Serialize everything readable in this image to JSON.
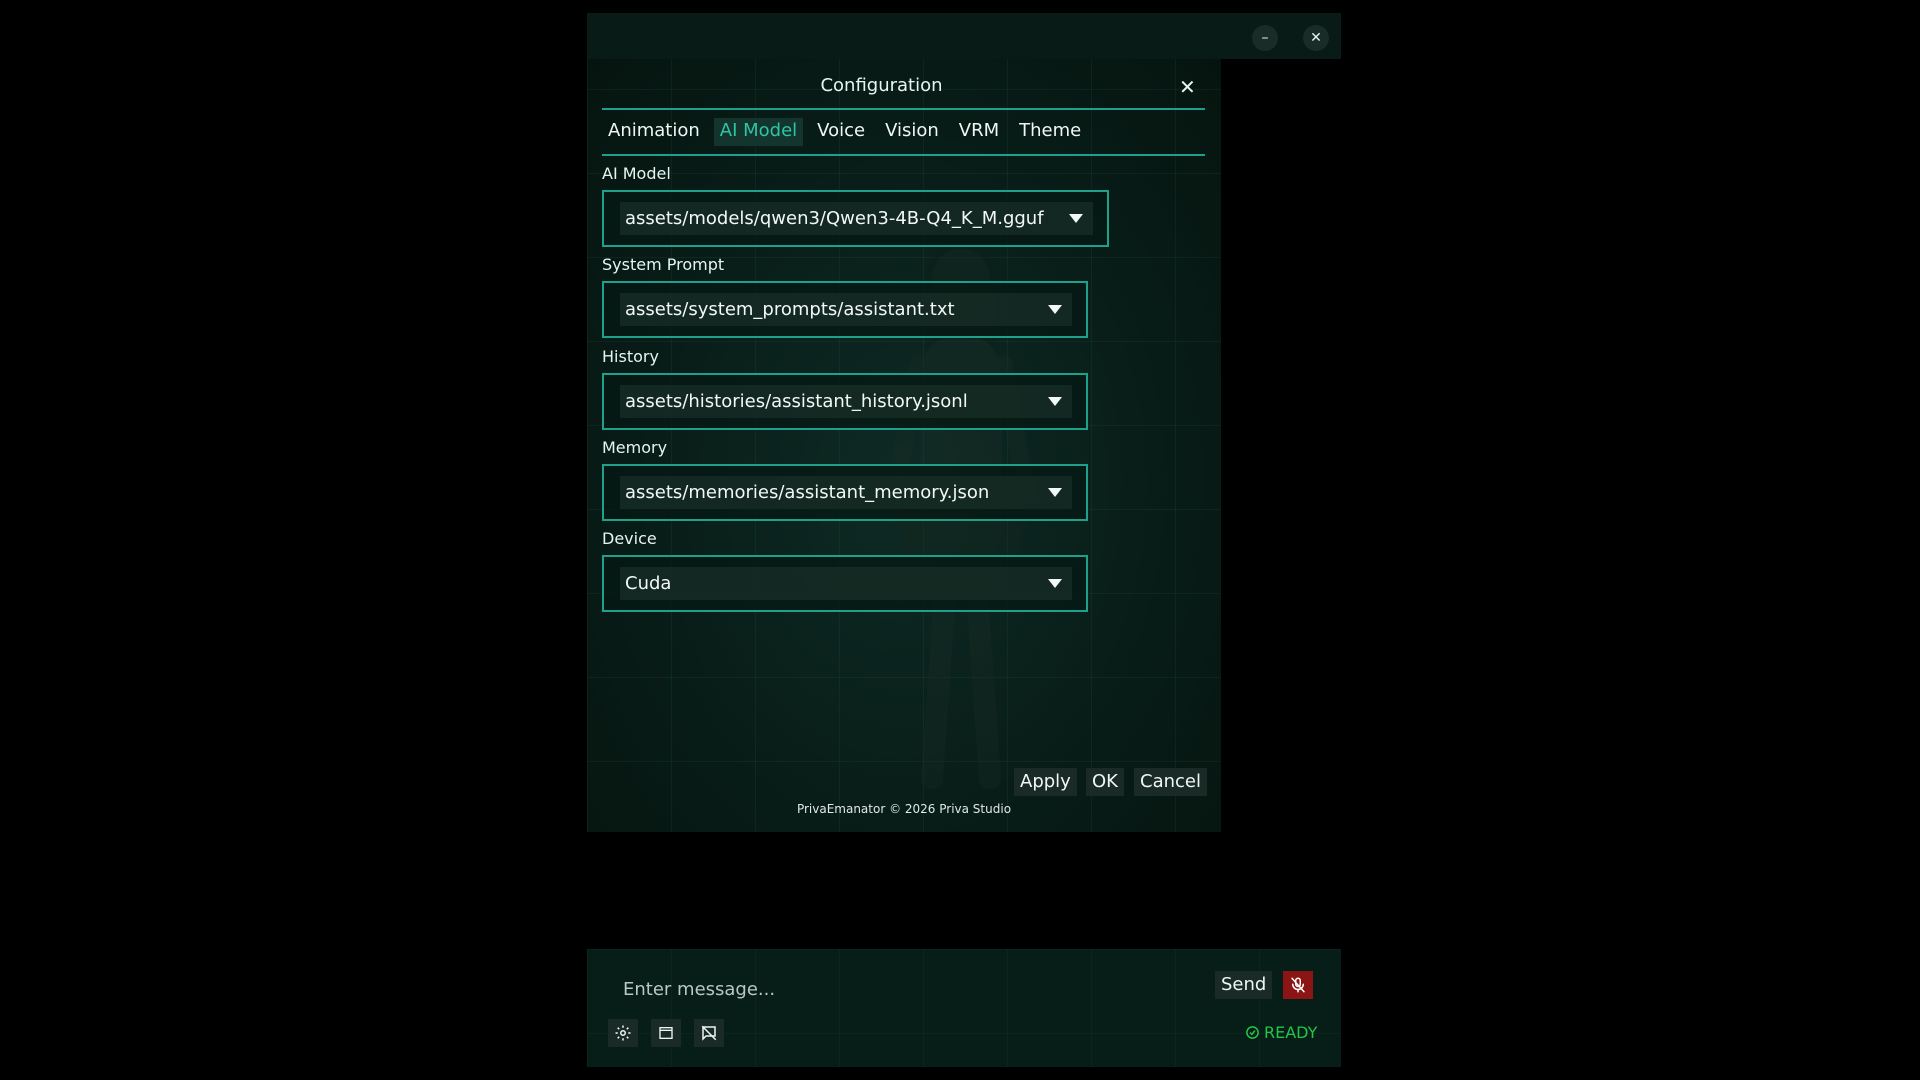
{
  "window": {
    "minimize_glyph": "–",
    "close_glyph": "✕"
  },
  "dialog": {
    "title": "Configuration",
    "close_glyph": "✕",
    "tabs": [
      {
        "label": "Animation",
        "active": false
      },
      {
        "label": "AI Model",
        "active": true
      },
      {
        "label": "Voice",
        "active": false
      },
      {
        "label": "Vision",
        "active": false
      },
      {
        "label": "VRM",
        "active": false
      },
      {
        "label": "Theme",
        "active": false
      }
    ],
    "fields": {
      "ai_model": {
        "label": "AI Model",
        "value": "assets/models/qwen3/Qwen3-4B-Q4_K_M.gguf"
      },
      "system_prompt": {
        "label": "System Prompt",
        "value": "assets/system_prompts/assistant.txt"
      },
      "history": {
        "label": "History",
        "value": "assets/histories/assistant_history.jsonl"
      },
      "memory": {
        "label": "Memory",
        "value": "assets/memories/assistant_memory.json"
      },
      "device": {
        "label": "Device",
        "value": "Cuda"
      }
    },
    "buttons": {
      "apply": "Apply",
      "ok": "OK",
      "cancel": "Cancel"
    },
    "copyright": "PrivaEmanator © 2026 Priva Studio"
  },
  "chat": {
    "placeholder": "Enter message...",
    "send_label": "Send",
    "status_text": "READY",
    "tools": [
      "settings-icon",
      "window-icon",
      "chat-off-icon"
    ]
  },
  "colors": {
    "accent": "#1ea08a",
    "active_tab_text": "#2fc4a6",
    "mic_muted": "#8b1414",
    "status_ready": "#22c447"
  }
}
